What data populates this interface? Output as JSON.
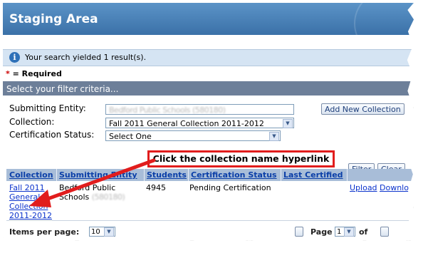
{
  "window": {
    "title": "Staging Area"
  },
  "info": {
    "message": "Your search yielded 1 result(s)."
  },
  "required": {
    "star": "*",
    "text": "= Required"
  },
  "filter": {
    "header": "Select your filter criteria...",
    "submitting_entity_label": "Submitting Entity:",
    "submitting_entity_value": "Bedford Public Schools (580180)",
    "collection_label": "Collection:",
    "collection_value": "Fall 2011 General Collection 2011-2012",
    "certification_label": "Certification Status:",
    "certification_value": "Select One",
    "add_new_collection_label": "Add New Collection",
    "filter_button_label": "Filter",
    "clear_button_label": "Clear"
  },
  "callout": {
    "text": "Click the collection name hyperlink",
    "color": "#e11d1d"
  },
  "table": {
    "headers": [
      "Collection",
      "Submitting Entity",
      "Students",
      "Certification Status",
      "Last Certified"
    ],
    "row": {
      "collection_line1": "Fall 2011",
      "collection_line2": "General",
      "collection_line3": "Collection",
      "collection_line4": "2011-2012",
      "entity_line1": "Bedford Public",
      "entity_line2": "Schools",
      "entity_code": "(580180)",
      "students": "4945",
      "certification_status": "Pending Certification",
      "last_certified": "",
      "upload_label": "Upload",
      "download_label": "Downloa"
    }
  },
  "pager": {
    "items_label": "Items per page:",
    "items_value": "10",
    "page_label": "Page",
    "page_value": "1",
    "of_label": "of"
  }
}
